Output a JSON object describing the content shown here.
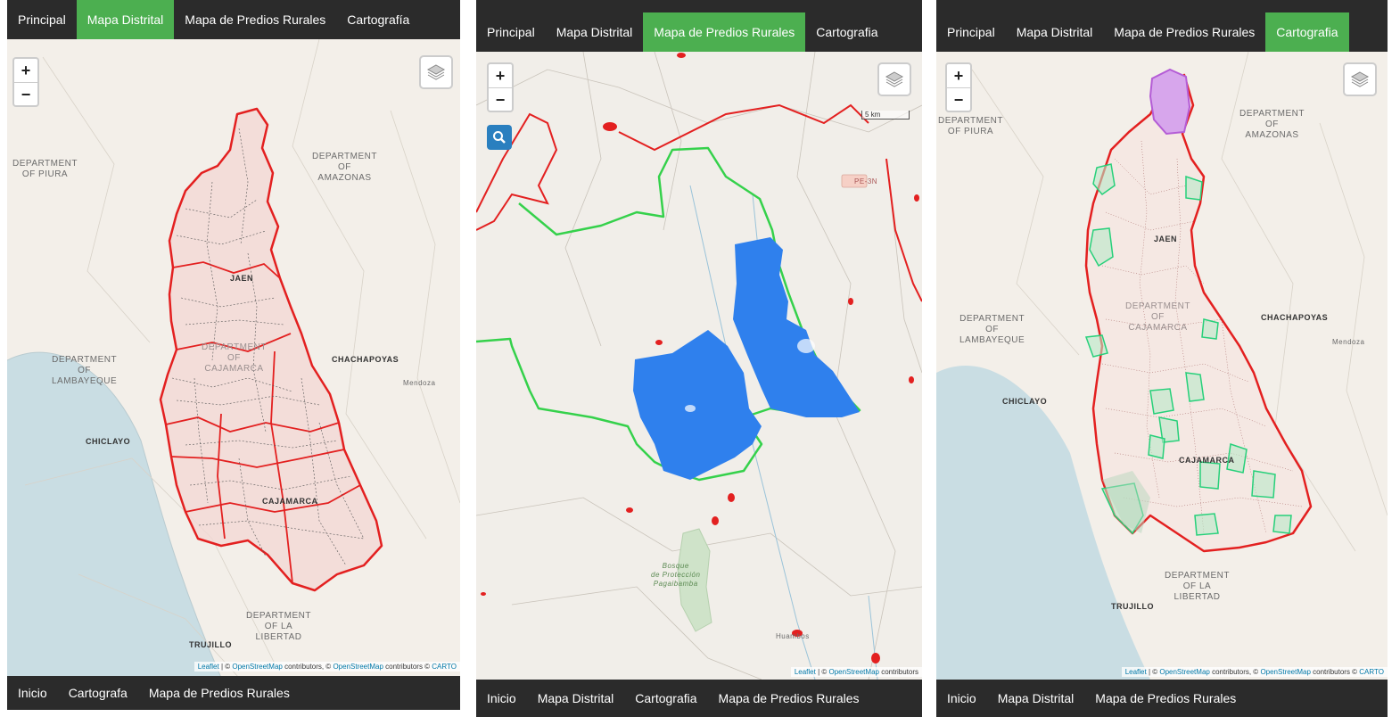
{
  "panels": [
    {
      "tabs": [
        {
          "label": "Principal",
          "active": false
        },
        {
          "label": "Mapa Distrital",
          "active": true
        },
        {
          "label": "Mapa de Predios Rurales",
          "active": false
        },
        {
          "label": "Cartografía",
          "active": false
        }
      ],
      "footer": [
        "Inicio",
        "Cartografa",
        "Mapa de Predios Rurales"
      ],
      "zoom": {
        "in": "+",
        "out": "−"
      },
      "labels": {
        "piura": "DEPARTMENT\nOF PIURA",
        "amazonas": "DEPARTMENT\nOF\nAMAZONAS",
        "jaen": "JAEN",
        "depcaj": "DEPARTMENT\nOF\nCAJAMARCA",
        "lambayeque": "DEPARTMENT\nOF\nLAMBAYEQUE",
        "chachapoyas": "CHACHAPOYAS",
        "mendoza": "Mendoza",
        "chiclayo": "CHICLAYO",
        "cajamarca": "CAJAMARCA",
        "libertad": "DEPARTMENT\nOF LA\nLIBERTAD",
        "trujillo": "TRUJILLO"
      },
      "attribution": {
        "leaflet": "Leaflet",
        "rest": " | © ",
        "osm": "OpenStreetMap",
        "contrib": " contributors, © ",
        "osm2": "OpenStreetMap",
        "contrib2": " contributors © ",
        "carto": "CARTO"
      }
    },
    {
      "tabs": [
        {
          "label": "Principal",
          "active": false
        },
        {
          "label": "Mapa Distrital",
          "active": false
        },
        {
          "label": "Mapa de Predios Rurales",
          "active": true
        },
        {
          "label": "Cartografia",
          "active": false
        }
      ],
      "footer": [
        "Inicio",
        "Mapa Distrital",
        "Cartografia",
        "Mapa de Predios Rurales"
      ],
      "zoom": {
        "in": "+",
        "out": "−"
      },
      "scale": "5 km",
      "labels": {
        "bosque": "Bosque\nde Protección\nPagaibamba",
        "huambos": "Huambos",
        "pe3n": "PE-3N"
      },
      "attribution": {
        "leaflet": "Leaflet",
        "rest": " | © ",
        "osm": "OpenStreetMap",
        "contrib": " contributors"
      }
    },
    {
      "tabs": [
        {
          "label": "Principal",
          "active": false
        },
        {
          "label": "Mapa Distrital",
          "active": false
        },
        {
          "label": "Mapa de Predios Rurales",
          "active": false
        },
        {
          "label": "Cartografia",
          "active": true
        }
      ],
      "footer": [
        "Inicio",
        "Mapa Distrital",
        "Mapa de Predios Rurales"
      ],
      "zoom": {
        "in": "+",
        "out": "−"
      },
      "labels": {
        "piura": "DEPARTMENT\nOF PIURA",
        "amazonas": "DEPARTMENT\nOF\nAMAZONAS",
        "jaen": "JAEN",
        "depcaj": "DEPARTMENT\nOF\nCAJAMARCA",
        "lambayeque": "DEPARTMENT\nOF\nLAMBAYEQUE",
        "chachapoyas": "CHACHAPOYAS",
        "mendoza": "Mendoza",
        "chiclayo": "CHICLAYO",
        "cajamarca": "CAJAMARCA",
        "libertad": "DEPARTMENT\nOF LA\nLIBERTAD",
        "trujillo": "TRUJILLO"
      },
      "attribution": {
        "leaflet": "Leaflet",
        "rest": " | © ",
        "osm": "OpenStreetMap",
        "contrib": " contributors, © ",
        "osm2": "OpenStreetMap",
        "contrib2": " contributors © ",
        "carto": "CARTO"
      }
    }
  ],
  "colors": {
    "nav": "#2b2b2b",
    "active_tab": "#4caf50",
    "boundary": "#e32020",
    "green_region": "#2ecc40",
    "blue_parcels": "#2f80ed",
    "teal_parcels": "#27d07a",
    "purple_region": "#b45cd6"
  }
}
